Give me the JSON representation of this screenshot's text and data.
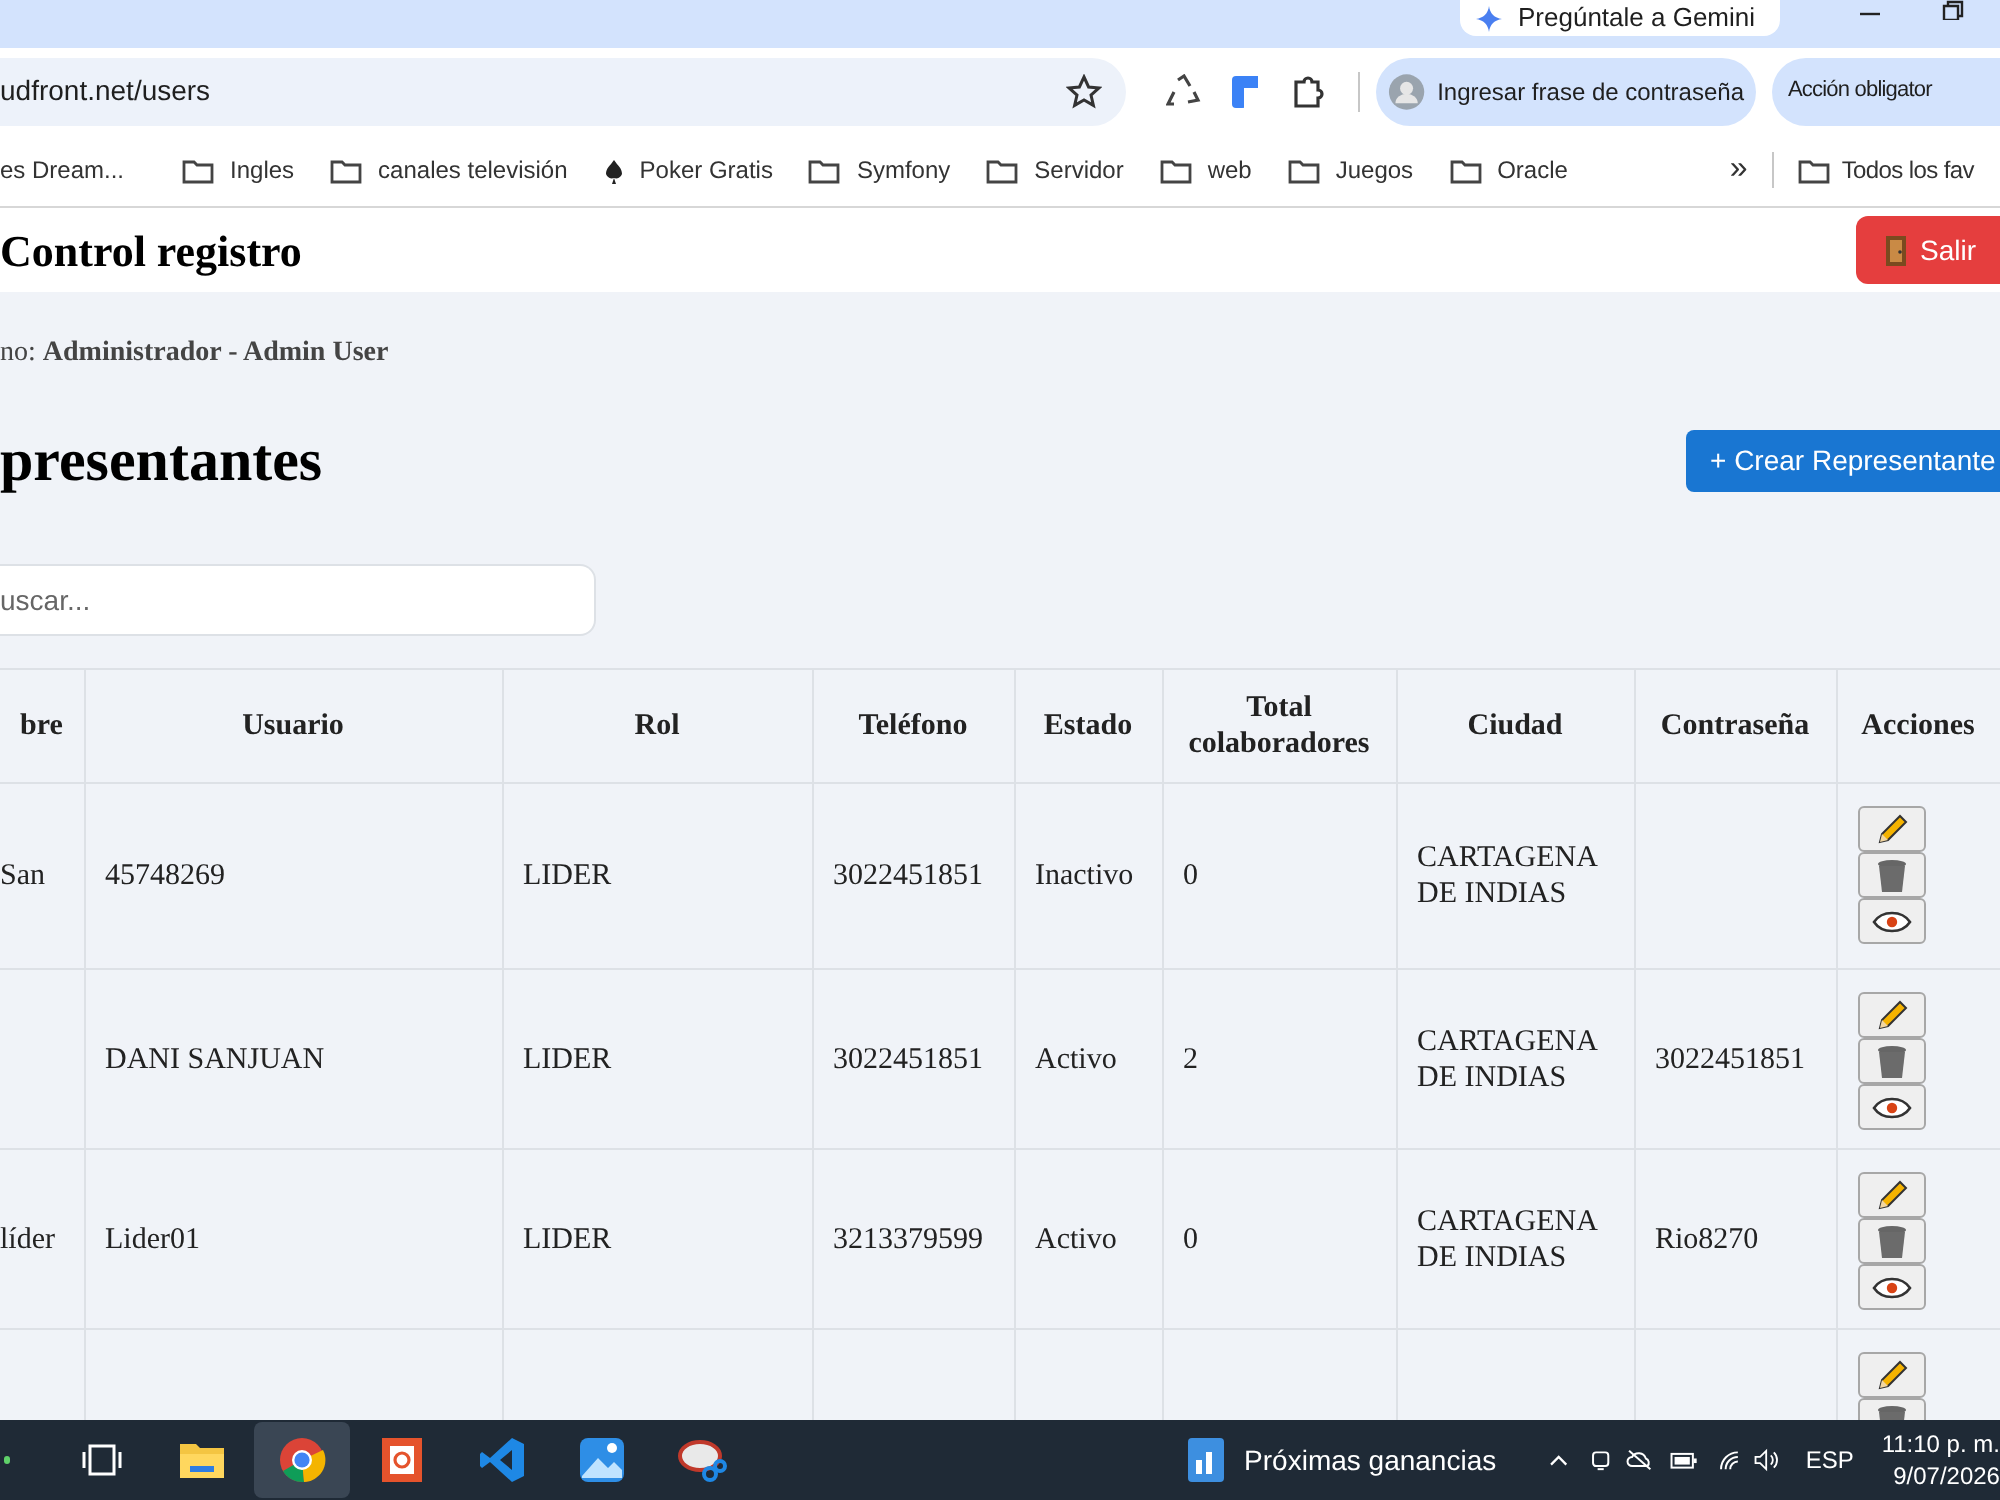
{
  "browser": {
    "gemini_button": "Pregúntale a Gemini",
    "address": {
      "url": "udfront.net/users"
    },
    "profile_chip": "Ingresar frase de contraseña",
    "action_chip": "Acción obligator",
    "bookmarks": [
      {
        "label": "es Dream...",
        "kind": "site"
      },
      {
        "label": "Ingles",
        "kind": "folder"
      },
      {
        "label": "canales televisión",
        "kind": "folder"
      },
      {
        "label": "Poker Gratis",
        "kind": "spade"
      },
      {
        "label": "Symfony",
        "kind": "folder"
      },
      {
        "label": "Servidor",
        "kind": "folder"
      },
      {
        "label": "web",
        "kind": "folder"
      },
      {
        "label": "Juegos",
        "kind": "folder"
      },
      {
        "label": "Oracle",
        "kind": "folder"
      }
    ],
    "bookmarks_more": "»",
    "all_bookmarks": "Todos los fav"
  },
  "page": {
    "title": "Control registro",
    "logout_button": "Salir",
    "user_line": "no: **Administrador - Admin User**",
    "heading": "presentantes",
    "create_button": "+ Crear Representante",
    "search": {
      "placeholder": "uscar..."
    },
    "table": {
      "columns": [
        "bre",
        "Usuario",
        "Rol",
        "Teléfono",
        "Estado",
        "Total colaboradores",
        "Ciudad",
        "Contraseña",
        "Acciones"
      ],
      "rows": [
        {
          "name": "San",
          "usuario": "45748269",
          "rol": "LIDER",
          "telefono": "3022451851",
          "estado": "Inactivo",
          "total": "0",
          "ciudad": "CARTAGENA DE INDIAS",
          "actions": [
            {
              "kind": "edit"
            },
            {
              "kind": "delete"
            },
            {
              "kind": "view"
            }
          ]
        },
        {
          "usuario": "DANI SANJUAN",
          "rol": "LIDER",
          "telefono": "3022451851",
          "estado": "Activo",
          "total": "2",
          "ciudad": "CARTAGENA DE INDIAS",
          "contrasena": "3022451851",
          "actions": [
            {
              "kind": "edit"
            },
            {
              "kind": "delete"
            },
            {
              "kind": "view"
            }
          ]
        },
        {
          "name": "líder",
          "usuario": "Lider01",
          "rol": "LIDER",
          "telefono": "3213379599",
          "estado": "Activo",
          "total": "0",
          "ciudad": "CARTAGENA DE INDIAS",
          "contrasena": "Rio8270",
          "actions": [
            {
              "kind": "edit"
            },
            {
              "kind": "delete"
            },
            {
              "kind": "view"
            }
          ]
        },
        {
          "actions": [
            {
              "kind": "edit"
            },
            {
              "kind": "delete"
            }
          ]
        }
      ]
    }
  },
  "taskbar": {
    "apps": [
      {
        "kind": "taskview",
        "selected": false
      },
      {
        "kind": "files",
        "selected": false
      },
      {
        "kind": "browser",
        "selected": true
      },
      {
        "kind": "office",
        "selected": false
      },
      {
        "kind": "code",
        "selected": false
      },
      {
        "kind": "photos",
        "selected": false
      },
      {
        "kind": "snip",
        "selected": false
      }
    ],
    "widget": "Próximas ganancias",
    "language": "ESP",
    "time": "11:10 p. m.",
    "date": "9/07/2026"
  }
}
